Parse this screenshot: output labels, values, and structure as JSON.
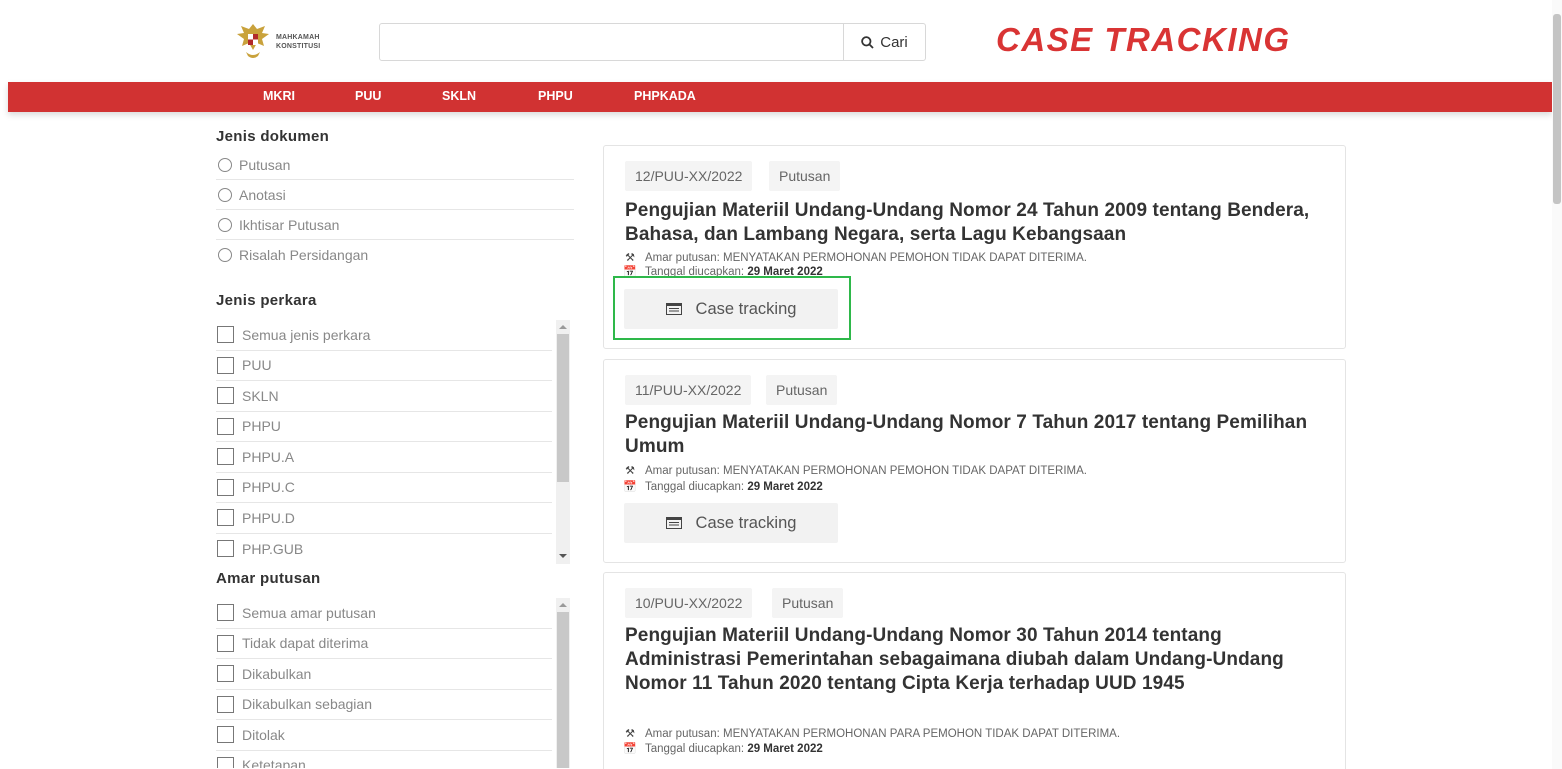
{
  "header": {
    "logo_text_line1": "MAHKAMAH",
    "logo_text_line2": "KONSTITUSI",
    "search_placeholder": "",
    "search_value": "",
    "search_button_label": "Cari",
    "brand_title": "CASE TRACKING",
    "brand_color": "#d93434"
  },
  "nav": {
    "color": "#d13232",
    "items": [
      "MKRI",
      "PUU",
      "SKLN",
      "PHPU",
      "PHPKADA"
    ]
  },
  "sidebar": {
    "jenis_dokumen": {
      "title": "Jenis dokumen",
      "options": [
        "Putusan",
        "Anotasi",
        "Ikhtisar Putusan",
        "Risalah Persidangan"
      ]
    },
    "jenis_perkara": {
      "title": "Jenis perkara",
      "options": [
        "Semua jenis perkara",
        "PUU",
        "SKLN",
        "PHPU",
        "PHPU.A",
        "PHPU.C",
        "PHPU.D",
        "PHP.GUB"
      ]
    },
    "amar_putusan": {
      "title": "Amar putusan",
      "options": [
        "Semua amar putusan",
        "Tidak dapat diterima",
        "Dikabulkan",
        "Dikabulkan sebagian",
        "Ditolak",
        "Ketetapan"
      ]
    }
  },
  "results": [
    {
      "number": "12/PUU-XX/2022",
      "type": "Putusan",
      "title": "Pengujian Materiil Undang-Undang Nomor 24 Tahun 2009 tentang Bendera, Bahasa, dan Lambang Negara, serta Lagu Kebangsaan",
      "amar_label": "Amar putusan:",
      "amar_value": "MENYATAKAN PERMOHONAN PEMOHON TIDAK DAPAT DITERIMA.",
      "tanggal_label": "Tanggal diucapkan:",
      "tanggal_value": "29 Maret 2022",
      "button_label": "Case tracking"
    },
    {
      "number": "11/PUU-XX/2022",
      "type": "Putusan",
      "title": "Pengujian Materiil Undang-Undang Nomor 7 Tahun 2017 tentang Pemilihan Umum",
      "amar_label": "Amar putusan:",
      "amar_value": "MENYATAKAN PERMOHONAN PEMOHON TIDAK DAPAT DITERIMA.",
      "tanggal_label": "Tanggal diucapkan:",
      "tanggal_value": "29 Maret 2022",
      "button_label": "Case tracking"
    },
    {
      "number": "10/PUU-XX/2022",
      "type": "Putusan",
      "title": "Pengujian Materiil Undang-Undang Nomor 30 Tahun 2014 tentang Administrasi Pemerintahan sebagaimana diubah dalam Undang-Undang Nomor 11 Tahun 2020 tentang Cipta Kerja terhadap UUD 1945",
      "amar_label": "Amar putusan:",
      "amar_value": "MENYATAKAN PERMOHONAN PARA PEMOHON TIDAK DAPAT DITERIMA.",
      "tanggal_label": "Tanggal diucapkan:",
      "tanggal_value": "29 Maret 2022"
    }
  ]
}
